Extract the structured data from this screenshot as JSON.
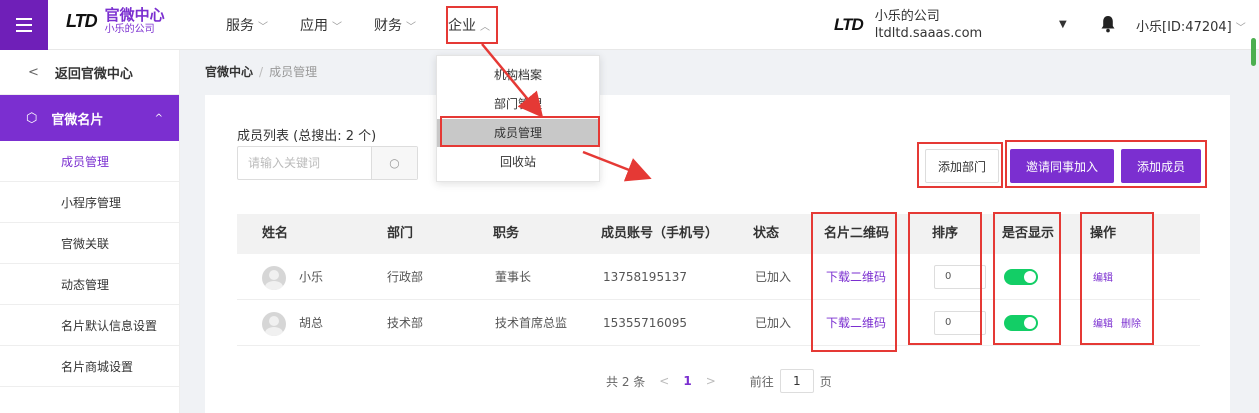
{
  "header": {
    "logo_mark": "LTD",
    "logo_title": "官微中心",
    "logo_subtitle": "小乐的公司",
    "nav": [
      {
        "label": "服务",
        "chevron": "﹀"
      },
      {
        "label": "应用",
        "chevron": "﹀"
      },
      {
        "label": "财务",
        "chevron": "﹀"
      },
      {
        "label": "企业",
        "chevron": "︿"
      }
    ],
    "company_mark": "LTD",
    "company_name": "小乐的公司",
    "company_domain": "ltdltd.saaas.com",
    "user": "小乐[ID:47204]",
    "user_chevron": "﹀",
    "caret": "▼"
  },
  "dropdown": {
    "items": [
      "机构档案",
      "部门管理",
      "成员管理",
      "回收站"
    ],
    "highlighted": "成员管理"
  },
  "sidebar": {
    "back_label": "返回官微中心",
    "back_arrow": "<",
    "section_label": "官微名片",
    "section_icon": "cube-icon",
    "section_glyph": "⬡",
    "section_arrow": "^",
    "items": [
      {
        "label": "成员管理",
        "active": true
      },
      {
        "label": "小程序管理"
      },
      {
        "label": "官微关联"
      },
      {
        "label": "动态管理"
      },
      {
        "label": "名片默认信息设置"
      },
      {
        "label": "名片商城设置"
      }
    ]
  },
  "breadcrumb": {
    "root": "官微中心",
    "separator": "/",
    "current": "成员管理"
  },
  "main": {
    "list_title": "成员列表 (总搜出: 2 个)",
    "search_placeholder": "请输入关键词",
    "search_icon_glyph": "○",
    "add_dept_label": "添加部门",
    "invite_label": "邀请同事加入",
    "add_member_label": "添加成员"
  },
  "table": {
    "headers": [
      "姓名",
      "部门",
      "职务",
      "成员账号（手机号）",
      "状态",
      "名片二维码",
      "排序",
      "是否显示",
      "操作"
    ],
    "rows": [
      {
        "name": "小乐",
        "dept": "行政部",
        "title": "董事长",
        "phone": "13758195137",
        "status": "已加入",
        "qr": "下载二维码",
        "sort": "0",
        "show": true,
        "ops": [
          "编辑"
        ]
      },
      {
        "name": "胡总",
        "dept": "技术部",
        "title": "技术首席总监",
        "phone": "15355716095",
        "status": "已加入",
        "qr": "下载二维码",
        "sort": "0",
        "show": true,
        "ops": [
          "编辑",
          "删除"
        ]
      }
    ]
  },
  "pagination": {
    "total": "共 2 条",
    "prev": "<",
    "next": ">",
    "current": "1",
    "goto": "前往",
    "page_value": "1",
    "page_unit": "页"
  },
  "colors": {
    "brand": "#7b2fd0",
    "toggle_on": "#13ce66",
    "annotation": "#e53935"
  }
}
